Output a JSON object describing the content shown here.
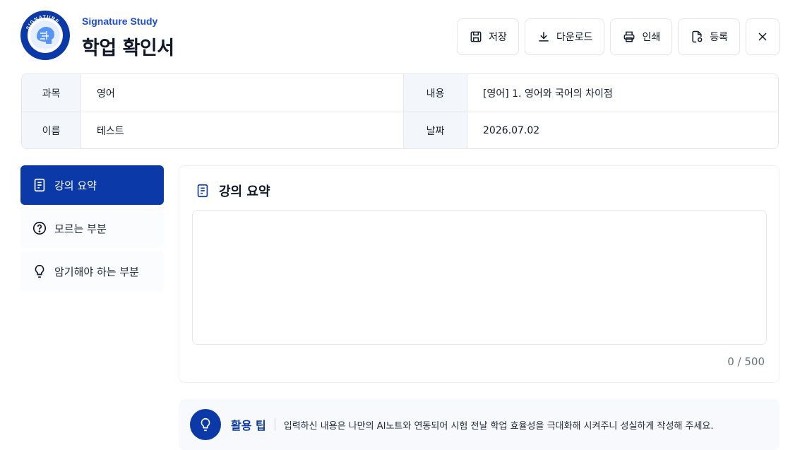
{
  "header": {
    "brand": "Signature Study",
    "title": "학업 확인서",
    "logo_ring_top": "SIGNATURE",
    "logo_ring_bottom": "STUDY"
  },
  "toolbar": {
    "save_label": "저장",
    "download_label": "다운로드",
    "print_label": "인쇄",
    "register_label": "등록"
  },
  "info": {
    "subject_label": "과목",
    "subject_value": "영어",
    "content_label": "내용",
    "content_value": "[영어] 1. 영어와 국어의 차이점",
    "name_label": "이름",
    "name_value": "테스트",
    "date_label": "날짜",
    "date_value": "2026.07.02"
  },
  "sidebar": {
    "items": [
      {
        "label": "강의 요약",
        "icon": "document-icon",
        "active": true
      },
      {
        "label": "모르는 부분",
        "icon": "question-icon",
        "active": false
      },
      {
        "label": "암기해야 하는 부분",
        "icon": "lightbulb-icon",
        "active": false
      }
    ]
  },
  "main": {
    "section_title": "강의 요약",
    "textarea_value": "",
    "counter": "0 / 500"
  },
  "tip": {
    "label": "활용 팁",
    "text": "입력하신 내용은 나만의 AI노트와 연동되어 시험 전날 학업 효율성을 극대화해 시켜주니 성실하게 작성해 주세요."
  },
  "colors": {
    "accent": "#0b3aa8",
    "brand_text": "#1d4ed8",
    "label_bg": "#f3f6fb",
    "border": "#e5e7eb"
  }
}
